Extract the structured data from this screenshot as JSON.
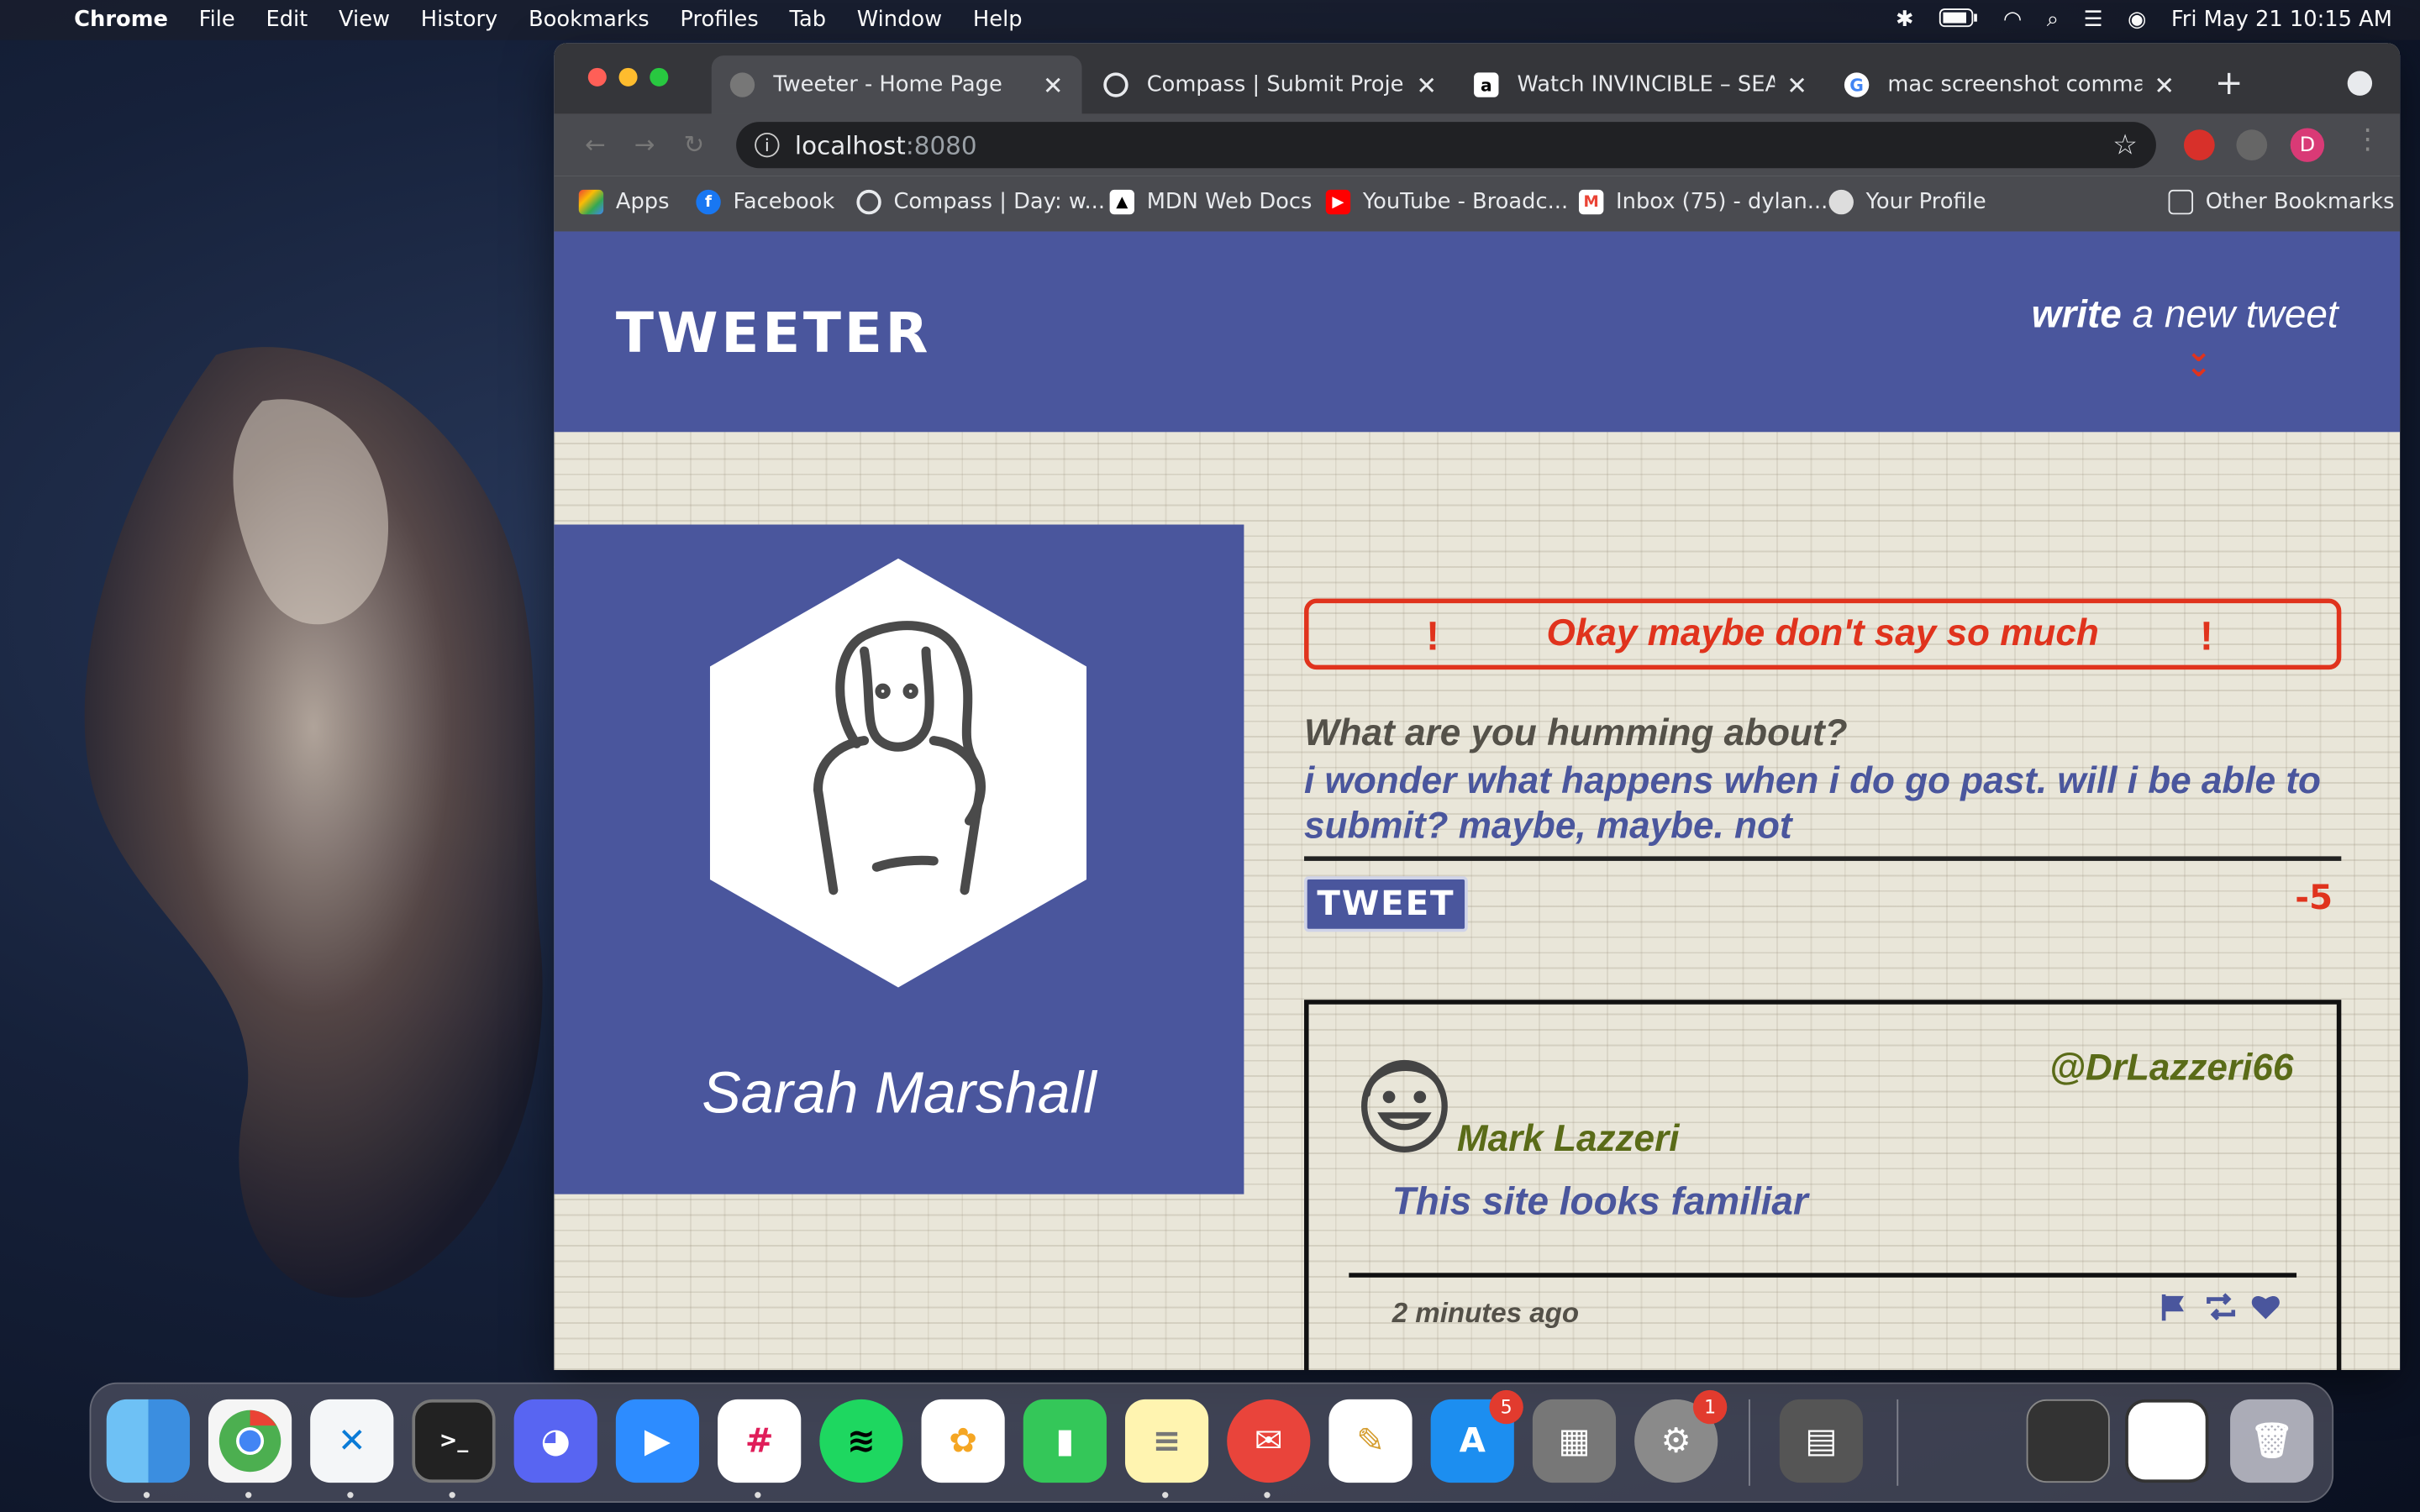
{
  "menubar": {
    "app": "Chrome",
    "items": [
      "File",
      "Edit",
      "View",
      "History",
      "Bookmarks",
      "Profiles",
      "Tab",
      "Window",
      "Help"
    ],
    "clock": "Fri May 21  10:15 AM"
  },
  "browser": {
    "tabs": [
      {
        "title": "Tweeter - Home Page"
      },
      {
        "title": "Compass | Submit Project fo"
      },
      {
        "title": "Watch INVINCIBLE – SEASO"
      },
      {
        "title": "mac screenshot command -"
      }
    ],
    "url_host": "localhost",
    "url_port": ":8080",
    "profile_initial": "D",
    "bookmarks": [
      "Apps",
      "Facebook",
      "Compass | Day: w...",
      "MDN Web Docs",
      "YouTube - Broadc...",
      "Inbox (75) - dylan...",
      "Your Profile"
    ],
    "other_bookmarks": "Other Bookmarks"
  },
  "page": {
    "brand": "TWEETER",
    "compose_bold": "write",
    "compose_rest": " a new tweet",
    "profile_name": "Sarah Marshall",
    "error_message": "Okay maybe don't say so much",
    "prompt": "What are you humming about?",
    "draft_text": "i wonder what happens when i do go past. will i be able to submit? maybe, maybe. not",
    "tweet_button": "TWEET",
    "counter": "-5",
    "tweet": {
      "handle": "@DrLazzeri66",
      "name": "Mark Lazzeri",
      "content": "This site looks familiar",
      "time": "2 minutes ago"
    },
    "colors": {
      "primary": "#4a569d",
      "error": "#e0331d",
      "handle": "#5a6b18"
    }
  },
  "dock": {
    "badges": {
      "appstore": "5",
      "settings": "1"
    }
  }
}
